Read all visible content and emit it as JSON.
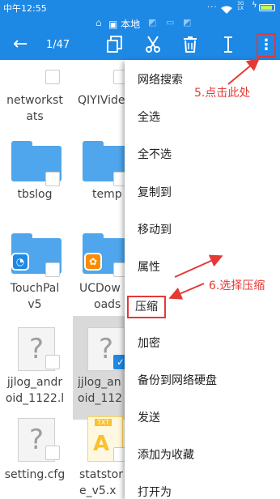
{
  "status_bar": {
    "time": "中午12:55",
    "dots": "...",
    "network_top": "3G",
    "network_bottom": "1X",
    "battery_color": "#b2ff59"
  },
  "location": {
    "label": "本地"
  },
  "toolbar": {
    "selection_count": "1/47",
    "icons": [
      "back-arrow-icon",
      "copy-icon",
      "cut-icon",
      "delete-icon",
      "rename-icon",
      "more-vert-icon"
    ]
  },
  "files": [
    {
      "name_line1": "networkst",
      "name_line2": "ats"
    },
    {
      "name_line1": "QIYIVide",
      "name_line2": ""
    },
    {
      "name_line1": "tbslog",
      "name_line2": ""
    },
    {
      "name_line1": "temp",
      "name_line2": ""
    },
    {
      "name_line1": "TouchPal",
      "name_line2": "v5"
    },
    {
      "name_line1": "UCDow",
      "name_line2": "oads"
    },
    {
      "name_line1": "jjlog_andr",
      "name_line2": "oid_1122.l"
    },
    {
      "name_line1": "jjlog_an",
      "name_line2": "oid_112"
    },
    {
      "name_line1": "setting.cfg",
      "name_line2": ""
    },
    {
      "name_line1": "statstor",
      "name_line2": "e_v5.x"
    }
  ],
  "menu": {
    "items": [
      "网络搜索",
      "全选",
      "全不选",
      "复制到",
      "移动到",
      "属性",
      "压缩",
      "加密",
      "备份到网络硬盘",
      "发送",
      "添加为收藏",
      "打开为"
    ]
  },
  "annotations": {
    "step5": "5.点击此处",
    "step6": "6.选择压缩",
    "color": "#e53935"
  },
  "colors": {
    "accent": "#1e88e5",
    "folder": "#4fa6ec"
  }
}
